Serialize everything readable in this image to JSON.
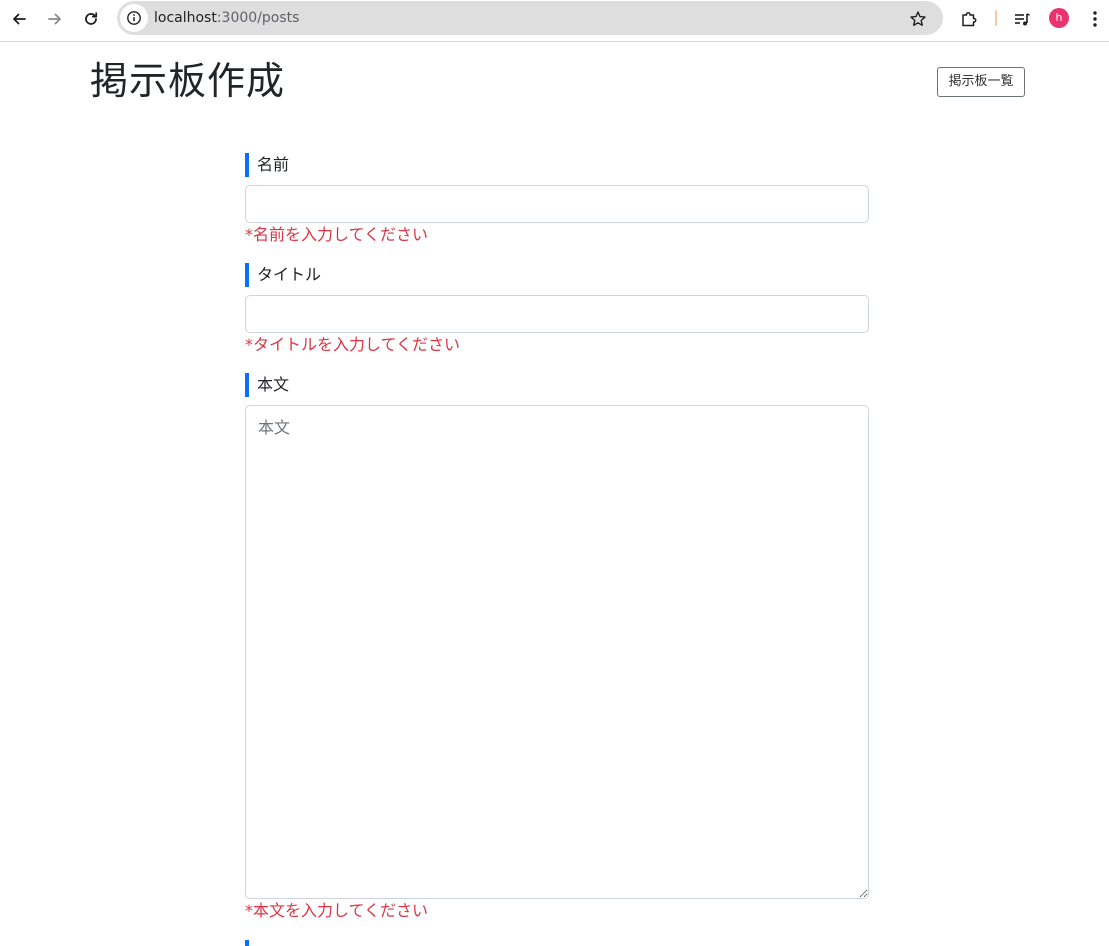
{
  "browser": {
    "url_host": "localhost",
    "url_path": ":3000/posts",
    "profile_initial": "h",
    "profile_color": "#e8336d"
  },
  "header": {
    "title": "掲示板作成",
    "list_button_label": "掲示板一覧"
  },
  "form": {
    "name": {
      "label": "名前",
      "value": "",
      "error": "*名前を入力してください"
    },
    "title": {
      "label": "タイトル",
      "value": "",
      "error": "*タイトルを入力してください"
    },
    "body": {
      "label": "本文",
      "placeholder": "本文",
      "value": "",
      "error": "*本文を入力してください"
    }
  },
  "colors": {
    "accent": "#0d6efd",
    "error": "#dc3545"
  }
}
